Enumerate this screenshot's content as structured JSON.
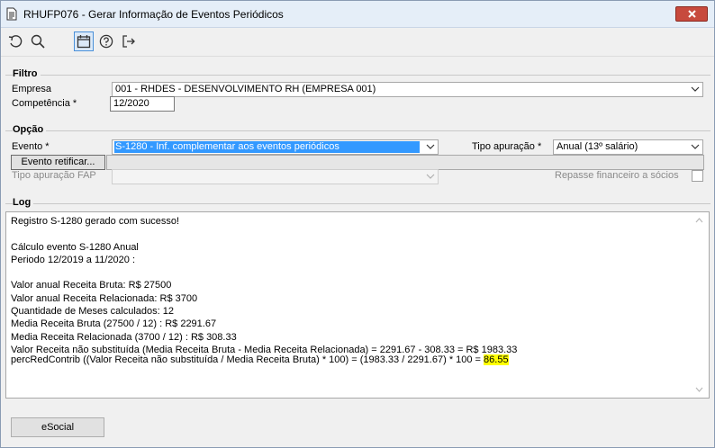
{
  "window": {
    "title": "RHUFP076 - Gerar Informação de Eventos Periódicos"
  },
  "toolbar": {
    "icons": [
      "undo-icon",
      "search-icon",
      "calendar-icon",
      "help-icon",
      "exit-icon"
    ]
  },
  "filtro": {
    "title": "Filtro",
    "empresa_label": "Empresa",
    "empresa_value": "001 - RHDES - DESENVOLVIMENTO RH (EMPRESA 001)",
    "competencia_label": "Competência *",
    "competencia_value": "12/2020"
  },
  "opcao": {
    "title": "Opção",
    "evento_label": "Evento *",
    "evento_value": "S-1280 - Inf. complementar aos eventos periódicos",
    "tipo_apuracao_label": "Tipo apuração *",
    "tipo_apuracao_value": "Anual (13º salário)",
    "evento_retificar_button": "Evento retificar...",
    "tipo_apuracao_fap_label": "Tipo apuração FAP",
    "tipo_apuracao_fap_value": "",
    "repasse_label": "Repasse financeiro a sócios"
  },
  "log": {
    "title": "Log",
    "lines": [
      "Registro S-1280 gerado com sucesso!",
      "",
      "Cálculo evento S-1280 Anual",
      "Periodo 12/2019 a 11/2020 :",
      "",
      "Valor anual Receita Bruta: R$ 27500",
      "Valor anual Receita Relacionada: R$ 3700",
      "Quantidade de Meses calculados: 12",
      "Media Receita Bruta (27500 / 12) : R$ 2291.67",
      "Media Receita Relacionada (3700 / 12) : R$ 308.33",
      "Valor Receita não substituída (Media Receita Bruta - Media Receita Relacionada) = 2291.67 - 308.33 = R$ 1983.33"
    ],
    "last_line_prefix": "percRedContrib ((Valor Receita não substituída / Media Receita Bruta) * 100) = (1983.33 / 2291.67) * 100 = ",
    "last_line_result": "86.55",
    "highlight_color": "#ffff00"
  },
  "footer": {
    "esocial_button": "eSocial"
  }
}
